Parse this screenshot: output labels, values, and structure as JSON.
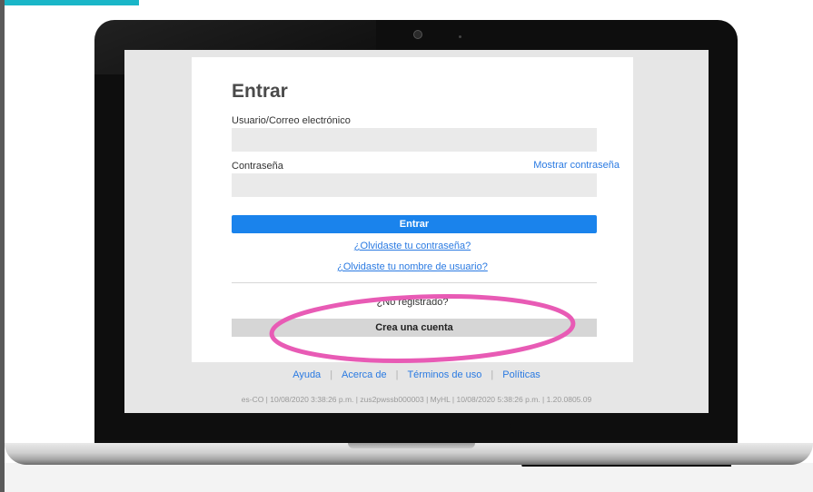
{
  "login": {
    "title": "Entrar",
    "username_label": "Usuario/Correo electrónico",
    "username_value": "",
    "password_label": "Contraseña",
    "password_value": "",
    "show_password_link": "Mostrar contraseña",
    "submit_label": "Entrar",
    "forgot_password_link": "¿Olvidaste tu contraseña?",
    "forgot_username_link": "¿Olvidaste tu nombre de usuario?",
    "not_registered_text": "¿No registrado?",
    "create_account_label": "Crea una cuenta"
  },
  "footer": {
    "links": [
      "Ayuda",
      "Acerca de",
      "Términos de uso",
      "Políticas"
    ],
    "info": "es-CO | 10/08/2020 3:38:26 p.m. | zus2pwssb000003 | MyHL | 10/08/2020 5:38:26 p.m. | 1.20.0805.09"
  },
  "colors": {
    "accent": "#1a83ec",
    "link": "#2a7ae2",
    "highlight_ring": "#e85bb5",
    "frame_tab": "#1ab6c8"
  }
}
